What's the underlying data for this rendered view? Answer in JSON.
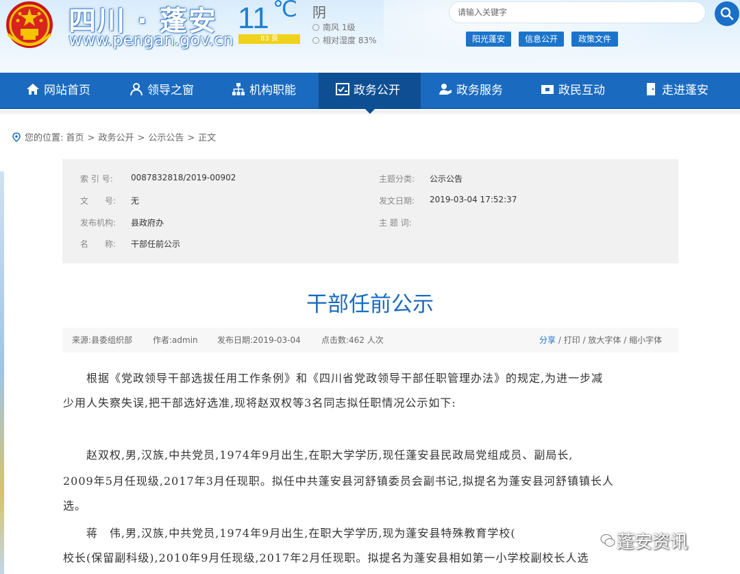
{
  "header": {
    "site_title": "四川 · 蓬安",
    "site_url": "www.pengan.gov.cn",
    "weather": {
      "temp": "11",
      "unit": "℃",
      "condition": "阴",
      "aqi": "83 良",
      "wind": "南风 1级",
      "humidity": "相对湿度 83%"
    },
    "search": {
      "placeholder": "请输入关键字"
    },
    "quick_links": [
      "阳光蓬安",
      "信息公开",
      "政策文件"
    ]
  },
  "nav": {
    "items": [
      {
        "label": "网站首页",
        "icon": "home-icon"
      },
      {
        "label": "领导之窗",
        "icon": "person-icon"
      },
      {
        "label": "机构职能",
        "icon": "org-chart-icon"
      },
      {
        "label": "政务公开",
        "icon": "checklist-icon",
        "active": true
      },
      {
        "label": "政务服务",
        "icon": "service-icon"
      },
      {
        "label": "政民互动",
        "icon": "interaction-icon"
      },
      {
        "label": "走进蓬安",
        "icon": "door-icon"
      }
    ]
  },
  "breadcrumb": {
    "prefix": "您的位置:",
    "items": [
      "首页",
      "政务公开",
      "公示公告",
      "正文"
    ],
    "sep": ">"
  },
  "meta": {
    "index_label": "索 引 号:",
    "index_value": "0087832818/2019-00902",
    "doc_label": "文　　号:",
    "doc_value": "无",
    "org_label": "发布机构:",
    "org_value": "县政府办",
    "name_label": "名　　称:",
    "name_value": "干部任前公示",
    "topic_label": "主题分类:",
    "topic_value": "公示公告",
    "date_label": "发文日期:",
    "date_value": "2019-03-04 17:52:37",
    "keyword_label": "主 题 词:",
    "keyword_value": ""
  },
  "article": {
    "title": "干部任前公示",
    "source": "来源:县委组织部",
    "author": "作者:admin",
    "date": "发布日期:2019-03-04",
    "clicks": "点击数:462 人次",
    "share": "分享",
    "print": "打印",
    "bigger": "放大字体",
    "smaller": "缩小字体",
    "p1_line1": "　　根据《党政领导干部选拔任用工作条例》和《四川省党政领导干部任职管理办法》的规定,为进一步减",
    "p1_line2": "少用人失察失误,把干部选好选准,现将赵双权等3名同志拟任职情况公示如下:",
    "p2_line1": "　　赵双权,男,汉族,中共党员,1974年9月出生,在职大学学历,现任蓬安县民政局党组成员、副局长,",
    "p2_line2": "2009年5月任现级,2017年3月任现职。拟任中共蓬安县河舒镇委员会副书记,拟提名为蓬安县河舒镇镇长人",
    "p2_line3": "选。",
    "p3_line1": "　　蒋　伟,男,汉族,中共党员,1974年9月出生,在职大学学历,现为蓬安县特殊教育学校(",
    "p3_line2": "校长(保留副科级),2010年9月任现级,2017年2月任现职。拟提名为蓬安县相如第一小学校副校长人选"
  },
  "watermark": "蓬安资讯"
}
